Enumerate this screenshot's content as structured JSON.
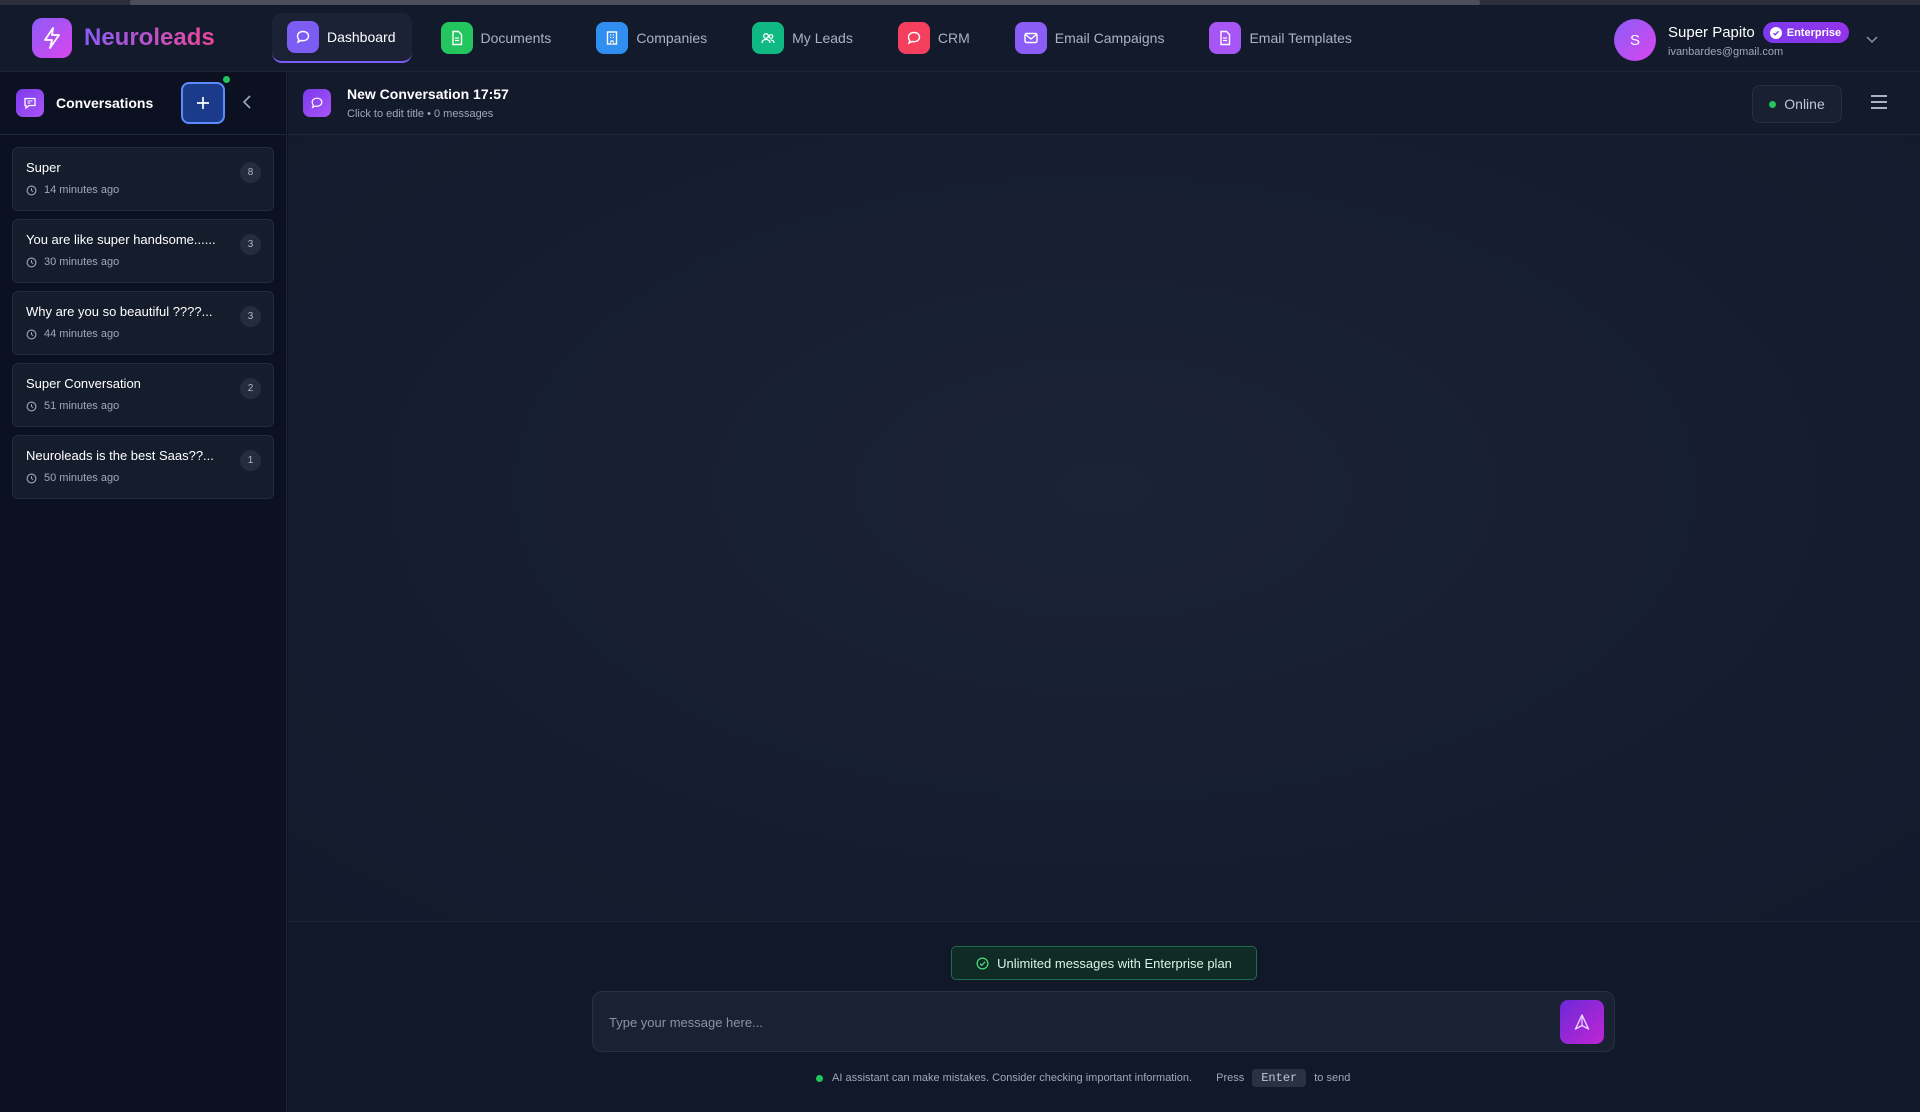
{
  "app": {
    "name": "Neuroleads"
  },
  "nav": [
    {
      "label": "Dashboard",
      "icon": "chat-bubble-icon",
      "color": "#7c5cf3",
      "active": true
    },
    {
      "label": "Documents",
      "icon": "document-icon",
      "color": "#22c55e",
      "active": false
    },
    {
      "label": "Companies",
      "icon": "building-icon",
      "color": "#2f8ef0",
      "active": false
    },
    {
      "label": "My Leads",
      "icon": "users-icon",
      "color": "#10b981",
      "active": false
    },
    {
      "label": "CRM",
      "icon": "chat-bubble-icon",
      "color": "#f43f5e",
      "active": false
    },
    {
      "label": "Email Campaigns",
      "icon": "mail-icon",
      "color": "#8b5cf6",
      "active": false
    },
    {
      "label": "Email Templates",
      "icon": "document-icon",
      "color": "#a855f7",
      "active": false
    }
  ],
  "user": {
    "initial": "S",
    "name": "Super Papito",
    "plan": "Enterprise",
    "email": "ivanbardes@gmail.com"
  },
  "sidebar": {
    "title": "Conversations",
    "conversations": [
      {
        "title": "Super",
        "time": "14 minutes ago",
        "count": "8"
      },
      {
        "title": "You are like super handsome......",
        "time": "30 minutes ago",
        "count": "3"
      },
      {
        "title": "Why are you so beautiful ????...",
        "time": "44 minutes ago",
        "count": "3"
      },
      {
        "title": "Super Conversation",
        "time": "51 minutes ago",
        "count": "2"
      },
      {
        "title": "Neuroleads is the best Saas??...",
        "time": "50 minutes ago",
        "count": "1"
      }
    ]
  },
  "chat": {
    "title": "New Conversation 17:57",
    "subtitle": "Click to edit title • 0 messages",
    "status": "Online"
  },
  "composer": {
    "plan_note": "Unlimited messages with Enterprise plan",
    "placeholder": "Type your message here...",
    "disclaimer": "AI assistant can make mistakes. Consider checking important information.",
    "press": "Press",
    "key": "Enter",
    "to_send": "to send"
  }
}
